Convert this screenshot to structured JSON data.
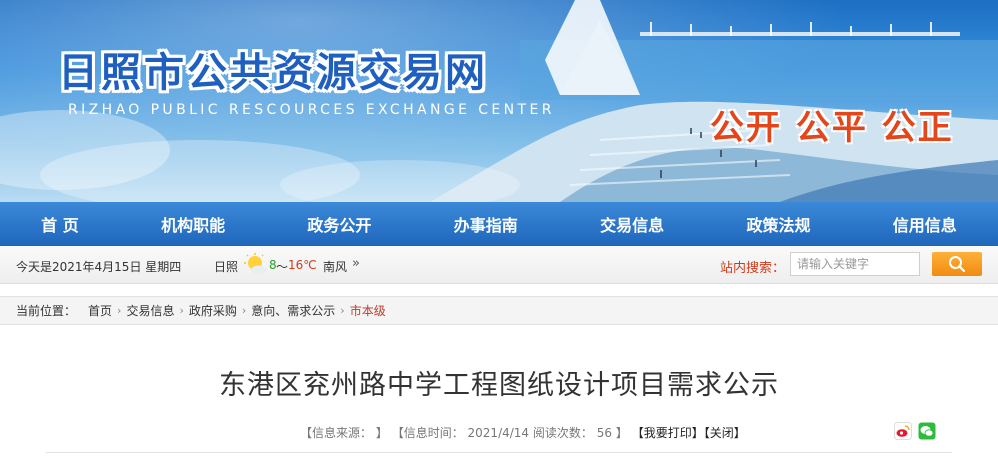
{
  "banner": {
    "title_cn": "日照市公共资源交易网",
    "title_en": "RIZHAO PUBLIC RESCOURCES EXCHANGE  CENTER",
    "slogan": "公开 公平 公正"
  },
  "nav": {
    "items": [
      "首 页",
      "机构职能",
      "政务公开",
      "办事指南",
      "交易信息",
      "政策法规",
      "信用信息"
    ]
  },
  "infobar": {
    "date": "今天是2021年4月15日 星期四",
    "city": "日照",
    "temp_low": "8",
    "temp_sep": "～",
    "temp_high": "16℃",
    "wind": "南风",
    "more": "»",
    "weather_icon": "sun-cloud-icon",
    "search_label": "站内搜索：",
    "search_placeholder": "请输入关键字",
    "search_icon": "search-icon"
  },
  "breadcrumb": {
    "label": "当前位置：",
    "items": [
      "首页",
      "交易信息",
      "政府采购",
      "意向、需求公示"
    ],
    "current": "市本级",
    "sep": "›"
  },
  "article": {
    "title": "东港区兖州路中学工程图纸设计项目需求公示",
    "source_label": "【信息来源：",
    "source_close": "】",
    "time_label": "【信息时间：",
    "time_value": "2021/4/14",
    "views_label": "阅读次数：",
    "views_value": "56",
    "views_close": "】",
    "print": "【我要打印】",
    "close": "【关闭】",
    "share_icons": [
      "weibo-icon",
      "wechat-icon"
    ]
  },
  "colors": {
    "nav_bg": "#1f66bb",
    "slogan": "#e2461a",
    "current_crumb": "#c0392b",
    "search_button": "#f08c10"
  }
}
